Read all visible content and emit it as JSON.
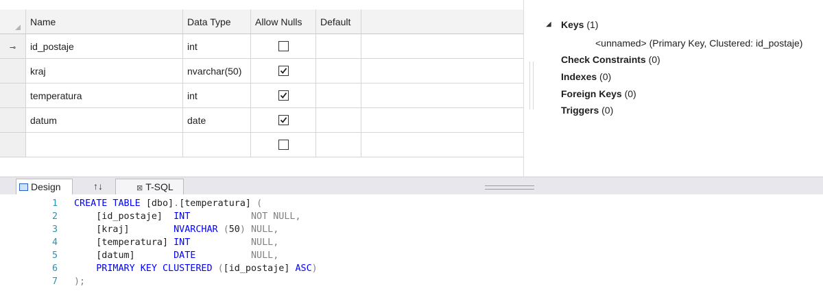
{
  "grid": {
    "headers": {
      "name": "Name",
      "data_type": "Data Type",
      "allow_nulls": "Allow Nulls",
      "default": "Default"
    },
    "rows": [
      {
        "key": true,
        "name": "id_postaje",
        "type": "int",
        "nullable": false
      },
      {
        "key": false,
        "name": "kraj",
        "type": "nvarchar(50)",
        "nullable": true
      },
      {
        "key": false,
        "name": "temperatura",
        "type": "int",
        "nullable": true
      },
      {
        "key": false,
        "name": "datum",
        "type": "date",
        "nullable": true
      },
      {
        "key": false,
        "name": "",
        "type": "",
        "nullable": false
      }
    ]
  },
  "properties": {
    "keys_label": "Keys",
    "keys_count": "(1)",
    "key_entry": "<unnamed>   (Primary Key, Clustered: id_postaje)",
    "check_label": "Check Constraints",
    "check_count": "(0)",
    "indexes_label": "Indexes",
    "indexes_count": "(0)",
    "foreign_label": "Foreign Keys",
    "foreign_count": "(0)",
    "triggers_label": "Triggers",
    "triggers_count": "(0)"
  },
  "tabs": {
    "design": "Design",
    "swap": "↑↓",
    "tsql": "T-SQL"
  },
  "code": {
    "lines": [
      {
        "n": "1",
        "tokens": [
          {
            "c": "kw",
            "t": "CREATE TABLE "
          },
          {
            "c": "pl",
            "t": "[dbo]"
          },
          {
            "c": "gr",
            "t": "."
          },
          {
            "c": "pl",
            "t": "[temperatura] "
          },
          {
            "c": "gr",
            "t": "("
          }
        ]
      },
      {
        "n": "2",
        "tokens": [
          {
            "c": "pl",
            "t": "    [id_postaje]  "
          },
          {
            "c": "kw",
            "t": "INT           "
          },
          {
            "c": "gr",
            "t": "NOT NULL,"
          }
        ]
      },
      {
        "n": "3",
        "tokens": [
          {
            "c": "pl",
            "t": "    [kraj]        "
          },
          {
            "c": "kw",
            "t": "NVARCHAR "
          },
          {
            "c": "gr",
            "t": "("
          },
          {
            "c": "pl",
            "t": "50"
          },
          {
            "c": "gr",
            "t": ") NULL,"
          }
        ]
      },
      {
        "n": "4",
        "tokens": [
          {
            "c": "pl",
            "t": "    [temperatura] "
          },
          {
            "c": "kw",
            "t": "INT           "
          },
          {
            "c": "gr",
            "t": "NULL,"
          }
        ]
      },
      {
        "n": "5",
        "tokens": [
          {
            "c": "pl",
            "t": "    [datum]       "
          },
          {
            "c": "kw",
            "t": "DATE          "
          },
          {
            "c": "gr",
            "t": "NULL,"
          }
        ]
      },
      {
        "n": "6",
        "tokens": [
          {
            "c": "kw",
            "t": "    PRIMARY KEY CLUSTERED "
          },
          {
            "c": "gr",
            "t": "("
          },
          {
            "c": "pl",
            "t": "[id_postaje] "
          },
          {
            "c": "kw",
            "t": "ASC"
          },
          {
            "c": "gr",
            "t": ")"
          }
        ]
      },
      {
        "n": "7",
        "tokens": [
          {
            "c": "gr",
            "t": ");"
          }
        ]
      }
    ]
  }
}
